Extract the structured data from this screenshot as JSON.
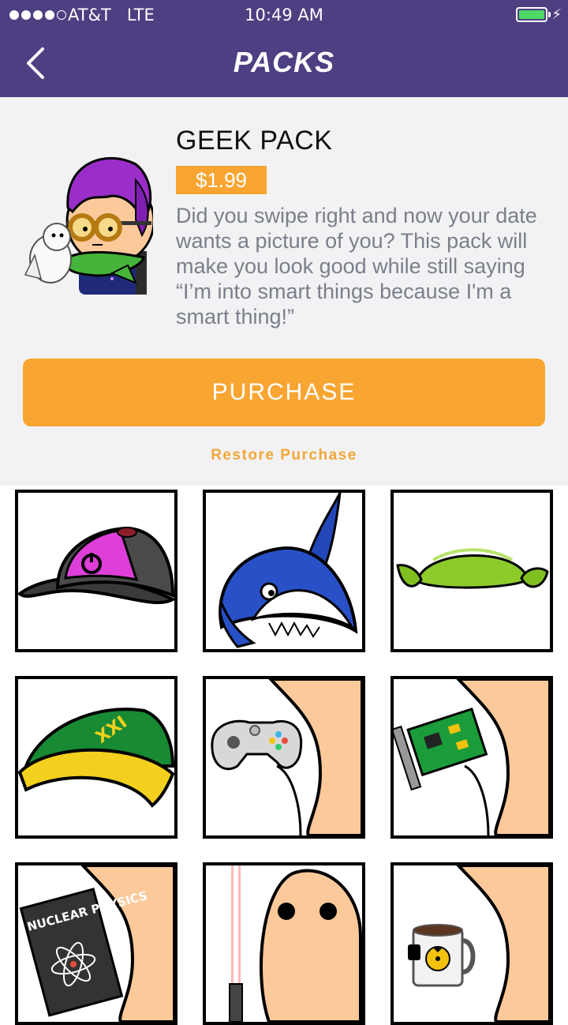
{
  "status_bar": {
    "carrier": "AT&T",
    "network": "LTE",
    "time": "10:49 AM",
    "signal_bars_filled": 4,
    "signal_bars_total": 5,
    "battery_level": 1.0,
    "charging": true
  },
  "nav": {
    "title": "PACKS",
    "back_icon": "chevron-left-icon"
  },
  "pack": {
    "name": "GEEK PACK",
    "price": "$1.99",
    "description": "Did you swipe right and now your date wants a picture of you? This pack will make you look good while still saying “I’m into smart things because I'm a smart thing!”",
    "purchase_label": "PURCHASE",
    "restore_label": "Restore Purchase"
  },
  "items": [
    "power-button-cap-icon",
    "shark-hat-icon",
    "elf-ears-hat-icon",
    "green-wizard-hat-icon",
    "game-controller-icon",
    "circuit-board-icon",
    "nuclear-physics-book-icon",
    "red-lightsaber-icon",
    "radioactive-mug-icon"
  ],
  "book_text": "NUCLEAR PHYSICS",
  "hat_text": "XXI",
  "colors": {
    "header": "#4e3f82",
    "accent": "#f9a532",
    "section_bg": "#f2f2f4",
    "description_text": "#7a7f8a",
    "skin": "#fcc99b"
  }
}
